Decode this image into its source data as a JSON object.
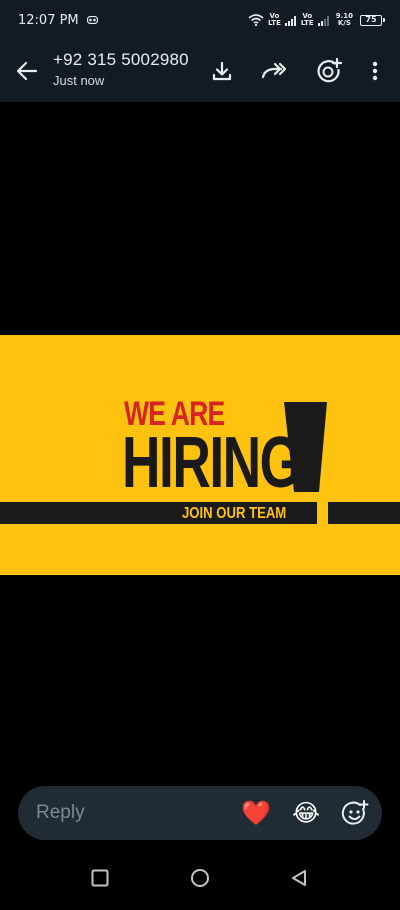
{
  "status_bar": {
    "time": "12:07 PM",
    "sim1": [
      "Vo",
      "LTE"
    ],
    "sim2": [
      "Vo",
      "LTE"
    ],
    "net_speed": [
      "9.10",
      "K/S"
    ],
    "battery": "75"
  },
  "header": {
    "contact": "+92 315 5002980",
    "subtitle": "Just now"
  },
  "poster": {
    "line1": "WE ARE",
    "line2": "HIRING",
    "line3": "JOIN OUR TEAM"
  },
  "reply": {
    "placeholder": "Reply",
    "reaction_heart": "❤️",
    "reaction_laugh": "😂"
  },
  "colors": {
    "header_bg": "#111b21",
    "poster_yellow": "#fec20f",
    "poster_red": "#d72323",
    "poster_dark": "#1a1a1a",
    "reply_bg": "#1f2c33"
  }
}
